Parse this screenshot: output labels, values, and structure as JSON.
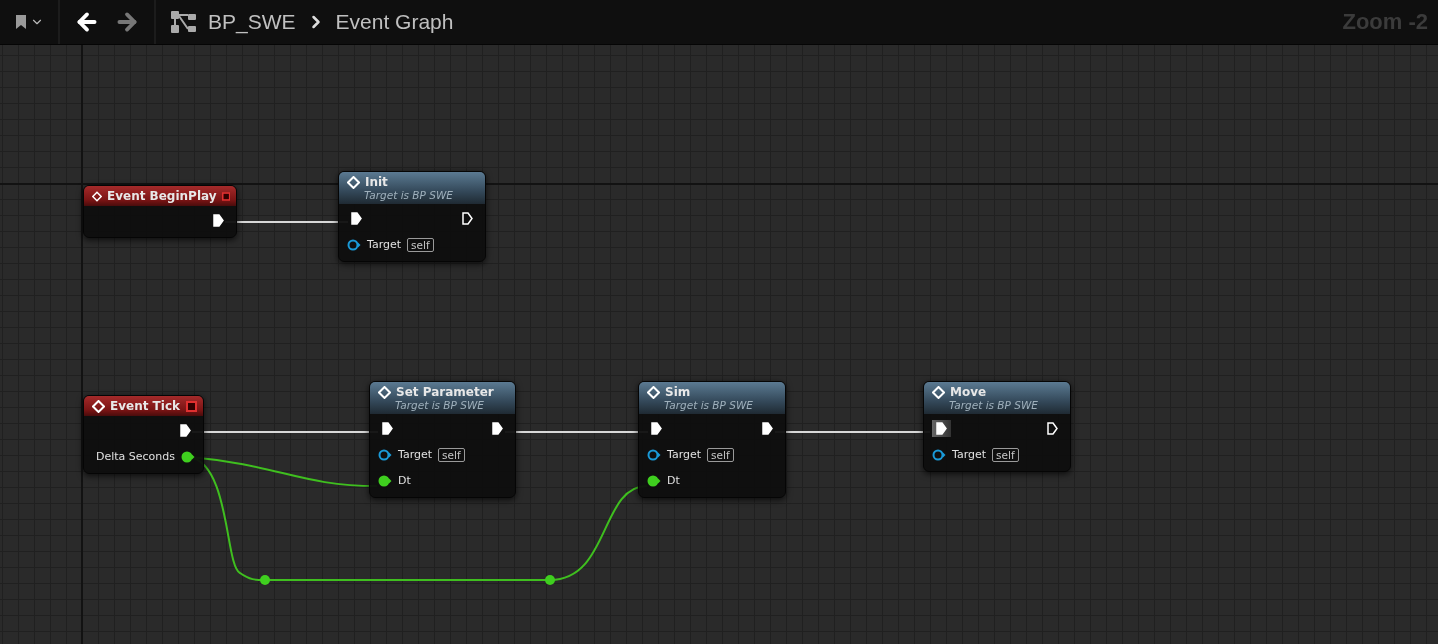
{
  "toolbar": {
    "breadcrumb": [
      "BP_SWE",
      "Event Graph"
    ],
    "zoom": "Zoom -2"
  },
  "nodes": [
    {
      "kind": "event",
      "title": "Event BeginPlay",
      "outputs": [
        {
          "kind": "exec",
          "connected": true,
          "highlighted": false
        }
      ]
    },
    {
      "kind": "function",
      "title": "Init",
      "subtitle": "Target is BP SWE",
      "inputs": [
        {
          "kind": "exec",
          "connected": true,
          "highlighted": false
        },
        {
          "kind": "object",
          "label": "Target",
          "default": "self",
          "connected": false
        }
      ],
      "outputs": [
        {
          "kind": "exec",
          "connected": false,
          "highlighted": false
        }
      ]
    },
    {
      "kind": "event",
      "title": "Event Tick",
      "outputs": [
        {
          "kind": "exec",
          "connected": true,
          "highlighted": false
        },
        {
          "kind": "float",
          "label": "Delta Seconds",
          "connected": true
        }
      ]
    },
    {
      "kind": "function",
      "title": "Set Parameter",
      "subtitle": "Target is BP SWE",
      "inputs": [
        {
          "kind": "exec",
          "connected": true,
          "highlighted": false
        },
        {
          "kind": "object",
          "label": "Target",
          "default": "self",
          "connected": false
        },
        {
          "kind": "float",
          "label": "Dt",
          "connected": true
        }
      ],
      "outputs": [
        {
          "kind": "exec",
          "connected": true,
          "highlighted": false
        }
      ]
    },
    {
      "kind": "function",
      "title": "Sim",
      "subtitle": "Target is BP SWE",
      "inputs": [
        {
          "kind": "exec",
          "connected": true,
          "highlighted": false
        },
        {
          "kind": "object",
          "label": "Target",
          "default": "self",
          "connected": false
        },
        {
          "kind": "float",
          "label": "Dt",
          "connected": true
        }
      ],
      "outputs": [
        {
          "kind": "exec",
          "connected": true,
          "highlighted": false
        }
      ]
    },
    {
      "kind": "function",
      "title": "Move",
      "subtitle": "Target is BP SWE",
      "inputs": [
        {
          "kind": "exec",
          "connected": true,
          "highlighted": true
        },
        {
          "kind": "object",
          "label": "Target",
          "default": "self",
          "connected": false
        }
      ],
      "outputs": [
        {
          "kind": "exec",
          "connected": false,
          "highlighted": false
        }
      ]
    }
  ]
}
